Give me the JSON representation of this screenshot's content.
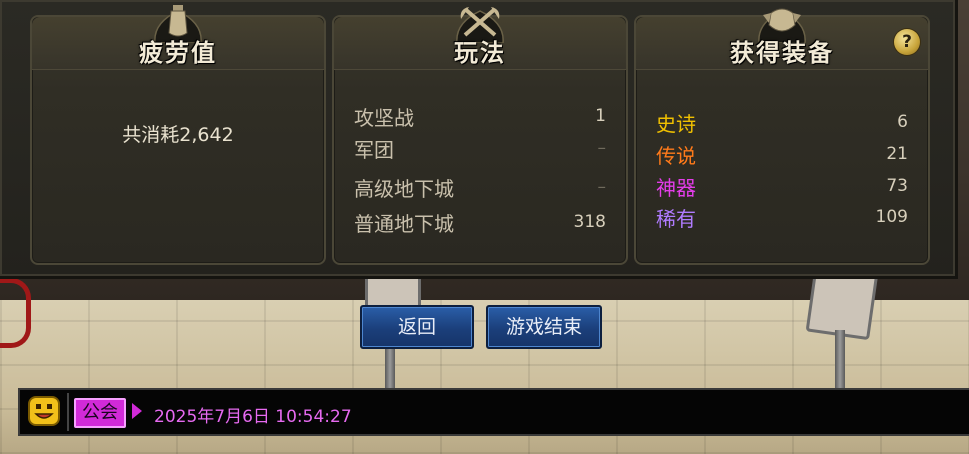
{
  "panels": {
    "fatigue": {
      "title": "疲劳值",
      "total_text": "共消耗2,642"
    },
    "gameplay": {
      "title": "玩法",
      "rows": [
        {
          "label": "攻坚战",
          "value": "1"
        },
        {
          "label": "军团",
          "value": "–"
        },
        {
          "label": "高级地下城",
          "value": "–"
        },
        {
          "label": "普通地下城",
          "value": "318"
        }
      ]
    },
    "equipment": {
      "title": "获得装备",
      "help_label": "?",
      "rows": [
        {
          "label": "史诗",
          "value": "6",
          "color": "#f0c000"
        },
        {
          "label": "传说",
          "value": "21",
          "color": "#ff7a1a"
        },
        {
          "label": "神器",
          "value": "73",
          "color": "#e23de8"
        },
        {
          "label": "稀有",
          "value": "109",
          "color": "#b07bff"
        }
      ]
    }
  },
  "buttons": {
    "back": "返回",
    "end_game": "游戏结束"
  },
  "chat": {
    "channel": "公会",
    "timestamp": "2025年7月6日 10:54:27",
    "icon": "emoji-face-icon"
  },
  "colors": {
    "button_blue": "#1b3f7b",
    "guild_magenta": "#d12ad8",
    "gold": "#f0c000"
  }
}
